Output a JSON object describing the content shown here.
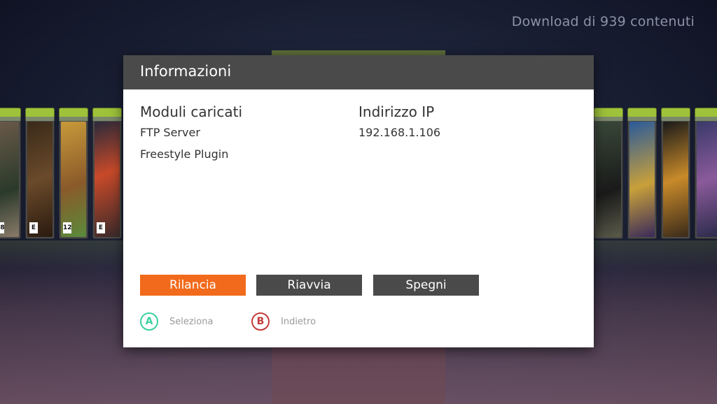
{
  "header": {
    "status": "Download di 939 contenuti"
  },
  "dialog": {
    "title": "Informazioni",
    "modules": {
      "heading": "Moduli caricati",
      "items": [
        "FTP Server",
        "Freestyle Plugin"
      ]
    },
    "ip": {
      "heading": "Indirizzo IP",
      "value": "192.168.1.106"
    },
    "buttons": {
      "relaunch": "Rilancia",
      "restart": "Riavvia",
      "shutdown": "Spegni"
    },
    "hints": {
      "a_letter": "A",
      "a_label": "Seleziona",
      "b_letter": "B",
      "b_label": "Indietro"
    }
  },
  "colors": {
    "accent_selected": "#f26a1b",
    "button_default": "#4a4a4a",
    "title_bar": "#4a4a4a",
    "a_button": "#3ad1a0",
    "b_button": "#c33a3a"
  },
  "icons": {
    "a_button": "a-button-icon",
    "b_button": "b-button-icon"
  }
}
